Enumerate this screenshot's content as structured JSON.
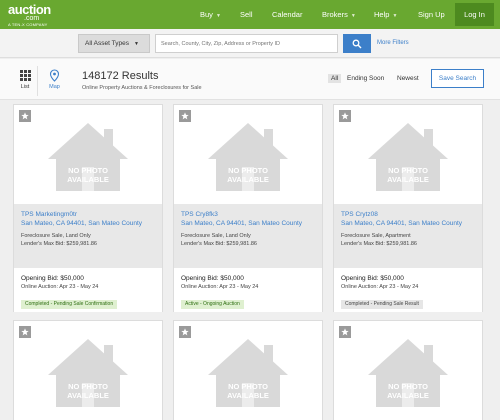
{
  "header": {
    "logo_brand": "auction",
    "logo_tld": ".com",
    "logo_sub": "A TEN-X COMPANY",
    "nav": [
      {
        "label": "Buy",
        "dropdown": true
      },
      {
        "label": "Sell",
        "dropdown": false
      },
      {
        "label": "Calendar",
        "dropdown": false
      },
      {
        "label": "Brokers",
        "dropdown": true
      },
      {
        "label": "Help",
        "dropdown": true
      },
      {
        "label": "Sign Up",
        "dropdown": false
      }
    ],
    "login_label": "Log In",
    "colors": {
      "bar": "#69a830",
      "login": "#4d8a1f"
    }
  },
  "search": {
    "asset_type": "All Asset Types",
    "placeholder": "Search, County, City, Zip, Address or Property ID",
    "more_filters": "More Filters",
    "button_icon": "search-icon"
  },
  "results": {
    "view_list": "List",
    "view_map": "Map",
    "count": "148172 Results",
    "subtitle": "Online Property Auctions & Foreclosures for Sale",
    "sort_all": "All",
    "sort_ending": "Ending Soon",
    "sort_newest": "Newest",
    "save_search": "Save Search"
  },
  "cards": [
    {
      "title": "TPS Marketingm0tr",
      "address": "San Mateo, CA 94401, San Mateo County",
      "sale_type": "Foreclosure Sale, Land Only",
      "max_bid": "Lender's Max Bid: $259,981.86",
      "opening_bid": "Opening Bid: $50,000",
      "auction_dates": "Online Auction: Apr 23 - May 24",
      "status": "Completed - Pending Sale Confirmation",
      "status_style": "green"
    },
    {
      "title": "TPS Cry8fk3",
      "address": "San Mateo, CA 94401, San Mateo County",
      "sale_type": "Foreclosure Sale, Land Only",
      "max_bid": "Lender's Max Bid: $259,981.86",
      "opening_bid": "Opening Bid: $50,000",
      "auction_dates": "Online Auction: Apr 23 - May 24",
      "status": "Active - Ongoing Auction",
      "status_style": "green"
    },
    {
      "title": "TPS Crytz08",
      "address": "San Mateo, CA 94401, San Mateo County",
      "sale_type": "Foreclosure Sale, Apartment",
      "max_bid": "Lender's Max Bid: $259,981.86",
      "opening_bid": "Opening Bid: $50,000",
      "auction_dates": "Online Auction: Apr 23 - May 24",
      "status": "Completed - Pending Sale Result",
      "status_style": "gray"
    }
  ],
  "no_photo_line1": "NO PHOTO",
  "no_photo_line2": "AVAILABLE"
}
